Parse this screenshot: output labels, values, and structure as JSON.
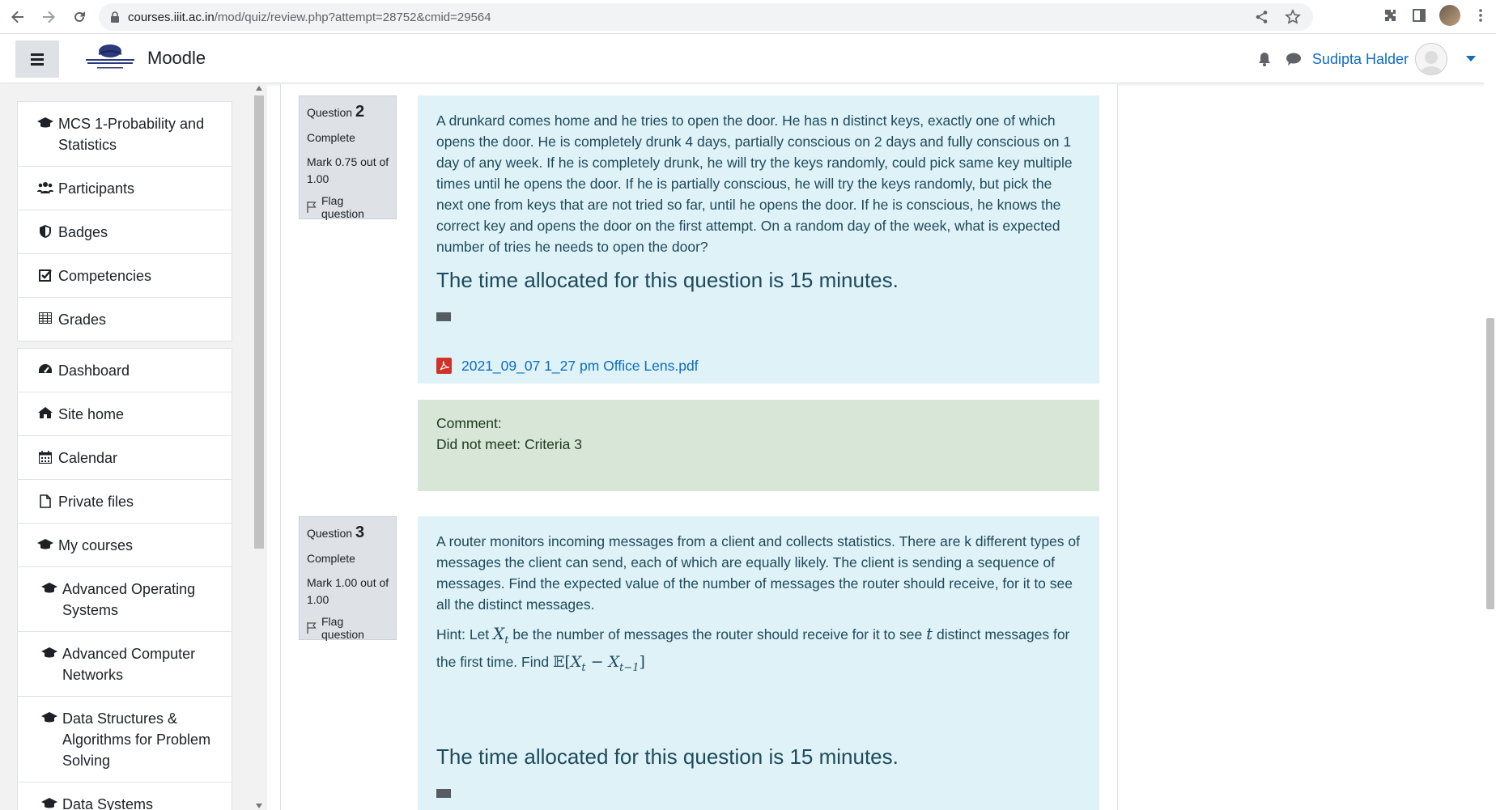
{
  "browser": {
    "url_host": "courses.iiit.ac.in",
    "url_path": "/mod/quiz/review.php?attempt=28752&cmid=29564"
  },
  "navbar": {
    "site_name": "Moodle",
    "logo_text": "INTERNATIONAL INSTITUTE OF INFORMATION TECHNOLOGY HYDERABAD",
    "user_name": "Sudipta Halder"
  },
  "sidebar": {
    "course_items": [
      {
        "label": "MCS 1-Probability and Statistics",
        "icon": "graduation-cap-icon"
      },
      {
        "label": "Participants",
        "icon": "users-icon"
      },
      {
        "label": "Badges",
        "icon": "shield-icon"
      },
      {
        "label": "Competencies",
        "icon": "check-square-icon"
      },
      {
        "label": "Grades",
        "icon": "table-icon"
      }
    ],
    "site_items": [
      {
        "label": "Dashboard",
        "icon": "dashboard-icon"
      },
      {
        "label": "Site home",
        "icon": "home-icon"
      },
      {
        "label": "Calendar",
        "icon": "calendar-icon"
      },
      {
        "label": "Private files",
        "icon": "file-icon"
      },
      {
        "label": "My courses",
        "icon": "graduation-cap-icon"
      },
      {
        "label": "Advanced Operating Systems",
        "icon": "graduation-cap-icon"
      },
      {
        "label": "Advanced Computer Networks",
        "icon": "graduation-cap-icon"
      },
      {
        "label": "Data Structures & Algorithms for Problem Solving",
        "icon": "graduation-cap-icon"
      },
      {
        "label": "Data Systems",
        "icon": "graduation-cap-icon"
      }
    ]
  },
  "questions": [
    {
      "label": "Question",
      "number": "2",
      "state": "Complete",
      "grade": "Mark 0.75 out of 1.00",
      "flag": "Flag question",
      "text": "A drunkard comes home and he tries to open the door. He has n distinct keys, exactly one of which opens the door. He is completely drunk 4 days, partially conscious on 2 days and fully conscious on 1 day of any week. If he is completely drunk, he will try the keys randomly, could pick same key multiple times until he opens the door. If he is partially conscious, he will try the keys randomly, but pick the next one from keys that are not tried so far, until he opens the door. If he is conscious, he knows the correct key and opens the door on the first attempt. On a random day of the week, what is expected number of tries he needs to open the door?",
      "time_note": "The time allocated for this question is 15 minutes.",
      "attachment": "2021_09_07 1_27 pm Office Lens.pdf",
      "comment_label": "Comment:",
      "comment_text": "Did not meet: Criteria 3"
    },
    {
      "label": "Question",
      "number": "3",
      "state": "Complete",
      "grade": "Mark 1.00 out of 1.00",
      "flag": "Flag question",
      "text": "A router monitors incoming messages from a client and collects statistics. There are k different types of messages the client can send, each of which are equally likely. The client is sending a sequence of messages. Find the expected value of the number of messages the router should receive, for it to see all the distinct messages.",
      "hint_a": "Hint: Let ",
      "hint_b": " be the number of messages the router should receive for it to see ",
      "hint_c": " distinct messages for the first time. Find ",
      "time_note": "The time allocated for this question is 15 minutes."
    }
  ]
}
